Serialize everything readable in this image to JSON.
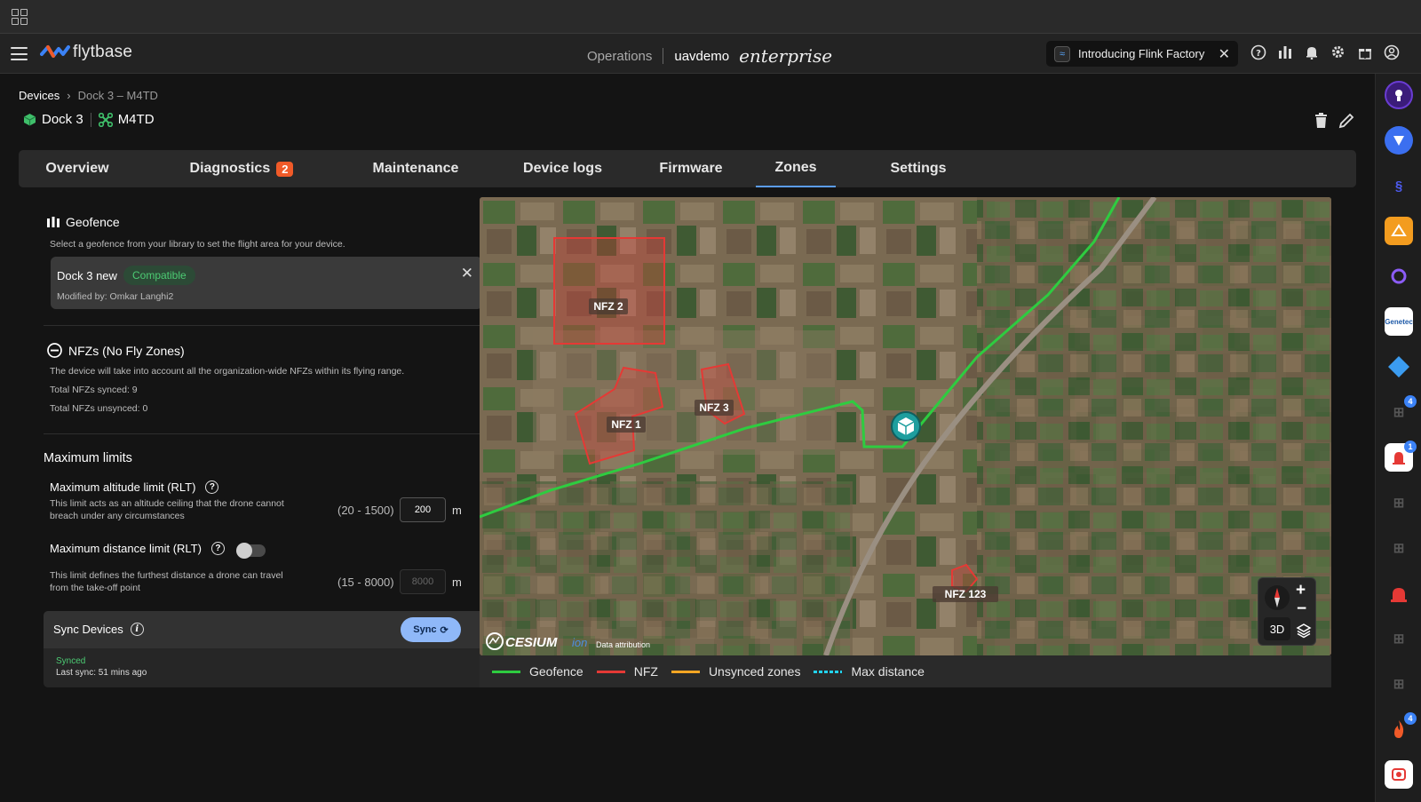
{
  "header": {
    "logo_text": "flytbase",
    "operations_label": "Operations",
    "org_name": "uavdemo",
    "plan_label": "enterprise",
    "promo_text": "Introducing Flink Factory"
  },
  "breadcrumb": {
    "root": "Devices",
    "current": "Dock 3 – M4TD"
  },
  "device": {
    "dock_name": "Dock 3",
    "drone_name": "M4TD"
  },
  "tabs": [
    {
      "label": "Overview"
    },
    {
      "label": "Diagnostics",
      "count": "2"
    },
    {
      "label": "Maintenance"
    },
    {
      "label": "Device logs"
    },
    {
      "label": "Firmware"
    },
    {
      "label": "Zones",
      "active": true
    },
    {
      "label": "Settings"
    }
  ],
  "geofence": {
    "title": "Geofence",
    "description": "Select a geofence from your library to set the flight area for your device.",
    "selected_name": "Dock 3 new",
    "status": "Compatible",
    "modified_by": "Modified by: Omkar Langhi2"
  },
  "nfz": {
    "title": "NFZs (No Fly Zones)",
    "description": "The device will take into account all the organization-wide NFZs within its flying range.",
    "synced": "Total NFZs synced: 9",
    "unsynced": "Total NFZs unsynced: 0"
  },
  "limits": {
    "title": "Maximum limits",
    "altitude": {
      "label": "Maximum altitude limit (RLT)",
      "desc_line1": "This limit acts as an altitude ceiling that the drone cannot",
      "desc_line2": "breach under any circumstances",
      "range": "(20 - 1500)",
      "value": "200",
      "unit": "m"
    },
    "distance": {
      "label": "Maximum distance limit (RLT)",
      "desc_line1": "This limit defines the furthest distance a drone can travel",
      "desc_line2": "from the take-off point",
      "range": "(15 - 8000)",
      "placeholder": "8000",
      "unit": "m",
      "enabled": false
    }
  },
  "sync": {
    "title": "Sync Devices",
    "button": "Sync",
    "status": "Synced",
    "last_sync": "Last sync: 51 mins ago"
  },
  "map": {
    "zones": [
      "NFZ 2",
      "NFZ 1",
      "NFZ 3",
      "NFZ 123"
    ],
    "attribution_logo": "CESIUM",
    "attribution_sub": "ion",
    "attribution": "Data attribution",
    "view_mode": "3D",
    "zoom_in": "+",
    "zoom_out": "−"
  },
  "legend": [
    {
      "label": "Geofence",
      "color": "#2ecc40"
    },
    {
      "label": "NFZ",
      "color": "#e53935"
    },
    {
      "label": "Unsynced zones",
      "color": "#f5a623"
    },
    {
      "label": "Max distance",
      "color": "#22d3ee"
    }
  ],
  "rail_badges": [
    "4",
    "1",
    "4"
  ]
}
